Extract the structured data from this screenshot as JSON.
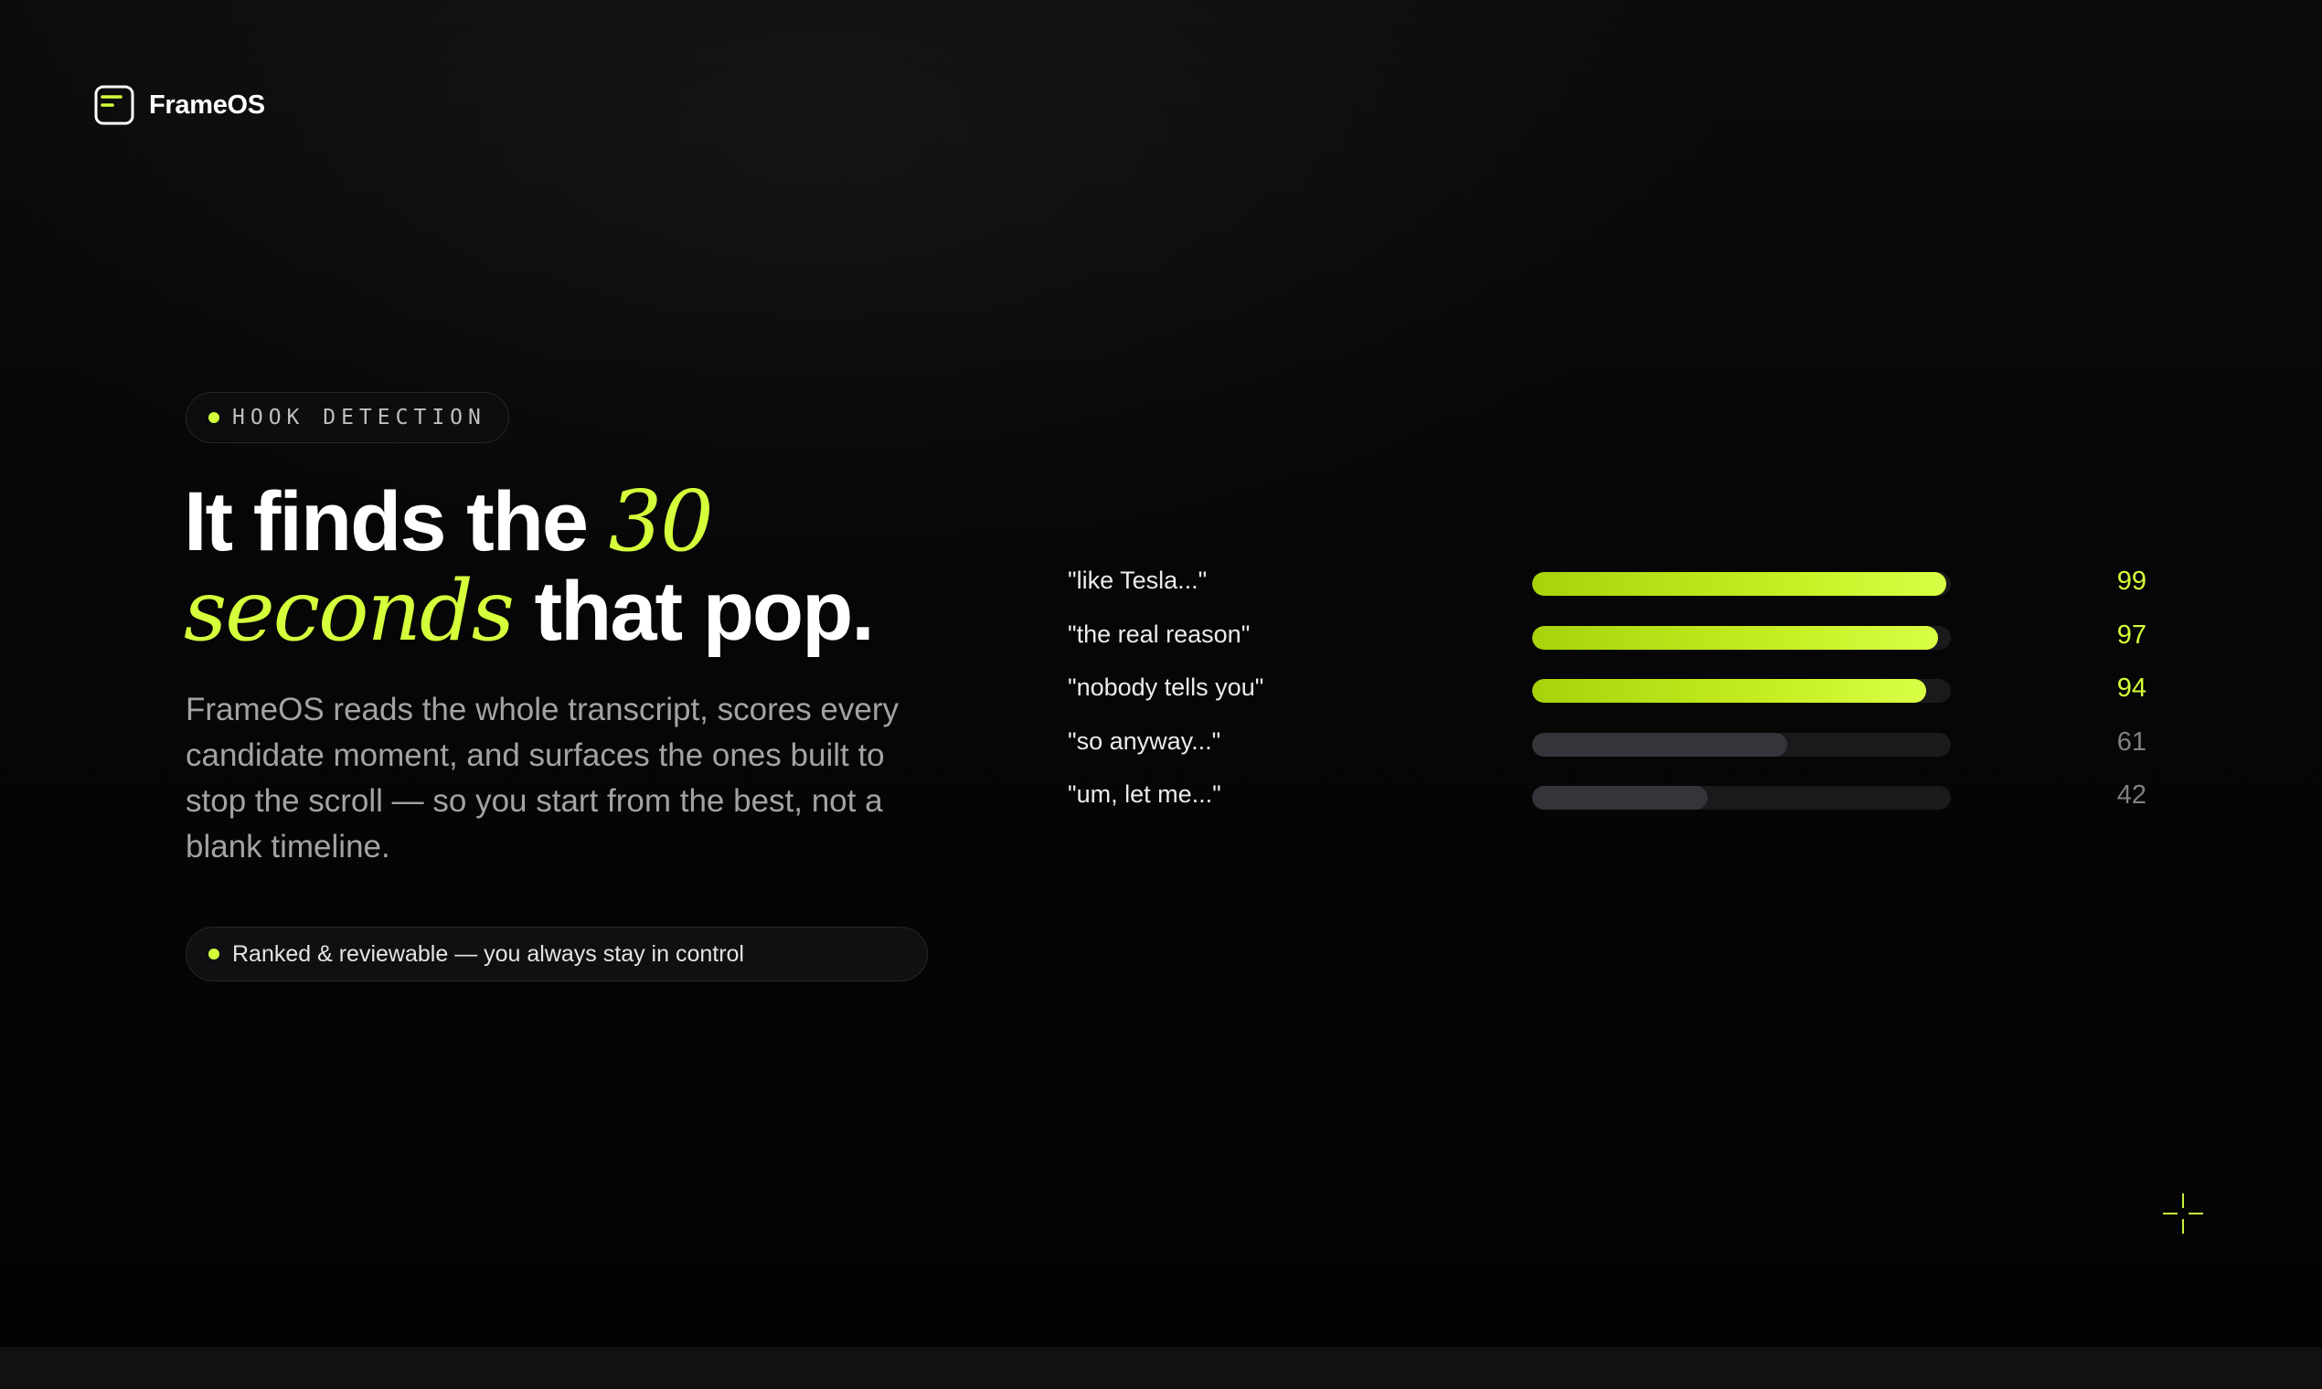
{
  "brand": {
    "name": "FrameOS",
    "logo_icon": "frame-icon",
    "accent_color": "#d4ff3a"
  },
  "eyebrow": {
    "label": "HOOK DETECTION"
  },
  "headline": {
    "part1": "It finds the ",
    "accent1": "30",
    "accent2": "seconds",
    "part2": " that pop."
  },
  "body": {
    "text": "FrameOS reads the whole transcript, scores every candidate moment, and surfaces the ones built to stop the scroll — so you start from the best, not a blank timeline."
  },
  "status": {
    "text": "Ranked & reviewable — you always stay in control"
  },
  "scores": {
    "max": 100,
    "highlight_threshold": 90,
    "items": [
      {
        "label": "\"like Tesla...\"",
        "score": 99,
        "value": "99"
      },
      {
        "label": "\"the real reason\"",
        "score": 97,
        "value": "97"
      },
      {
        "label": "\"nobody tells you\"",
        "score": 94,
        "value": "94"
      },
      {
        "label": "\"so anyway...\"",
        "score": 61,
        "value": "61"
      },
      {
        "label": "\"um, let me...\"",
        "score": 42,
        "value": "42"
      }
    ]
  },
  "decor": {
    "crosshair_icon": "crosshair-icon"
  }
}
